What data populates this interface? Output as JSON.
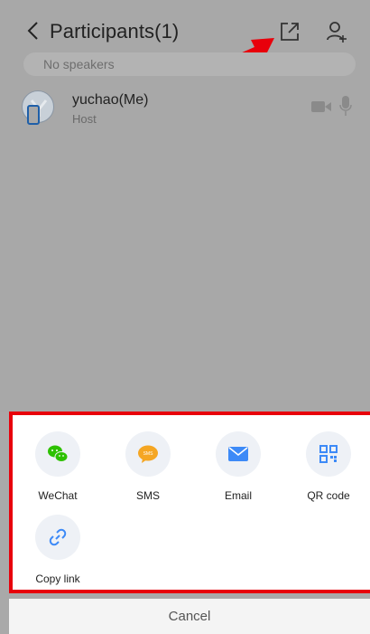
{
  "header": {
    "title": "Participants(1)",
    "back_icon": "chevron-left-icon",
    "share_icon": "share-export-icon",
    "add_icon": "add-user-icon"
  },
  "speaker_bar": {
    "text": "No speakers"
  },
  "participants": [
    {
      "name": "yuchao(Me)",
      "role": "Host"
    }
  ],
  "share_sheet": {
    "items": [
      {
        "label": "WeChat",
        "icon": "wechat-icon",
        "color": "#2dc100"
      },
      {
        "label": "SMS",
        "icon": "sms-icon",
        "color": "#f5a623"
      },
      {
        "label": "Email",
        "icon": "email-icon",
        "color": "#3d8af7"
      },
      {
        "label": "QR code",
        "icon": "qr-code-icon",
        "color": "#3d8af7"
      },
      {
        "label": "Copy link",
        "icon": "link-icon",
        "color": "#3d8af7"
      }
    ],
    "sms_glyph": "SMS",
    "cancel_label": "Cancel"
  },
  "colors": {
    "highlight": "#e8000b",
    "dim_overlay": "#a8a8a8"
  }
}
